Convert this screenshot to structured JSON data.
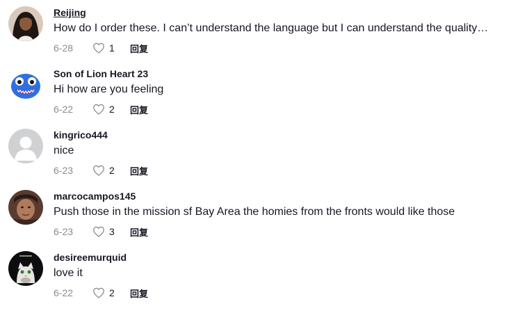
{
  "comments": [
    {
      "username": "Reijing",
      "text": "How do I order these. I can’t understand the language but I can understand the quality…",
      "date": "6-28",
      "likes": "1",
      "reply_label": "回复",
      "avatar_icon": "user-photo-avatar"
    },
    {
      "username": "Son of Lion Heart 23",
      "text": "Hi how are you feeling",
      "date": "6-22",
      "likes": "2",
      "reply_label": "回复",
      "avatar_icon": "blue-monster-avatar"
    },
    {
      "username": "kingrico444",
      "text": "nice",
      "date": "6-23",
      "likes": "2",
      "reply_label": "回复",
      "avatar_icon": "default-avatar"
    },
    {
      "username": "marcocampos145",
      "text": "Push those in the mission sf Bay Area the homies from the fronts would like those",
      "date": "6-23",
      "likes": "3",
      "reply_label": "回复",
      "avatar_icon": "user-photo-avatar"
    },
    {
      "username": "desireemurquid",
      "text": "love it",
      "date": "6-22",
      "likes": "2",
      "reply_label": "回复",
      "avatar_icon": "cat-photo-avatar"
    }
  ],
  "colors": {
    "text_primary": "#161823",
    "text_secondary": "#8a8b91",
    "heart_outline": "#8a8b91"
  }
}
